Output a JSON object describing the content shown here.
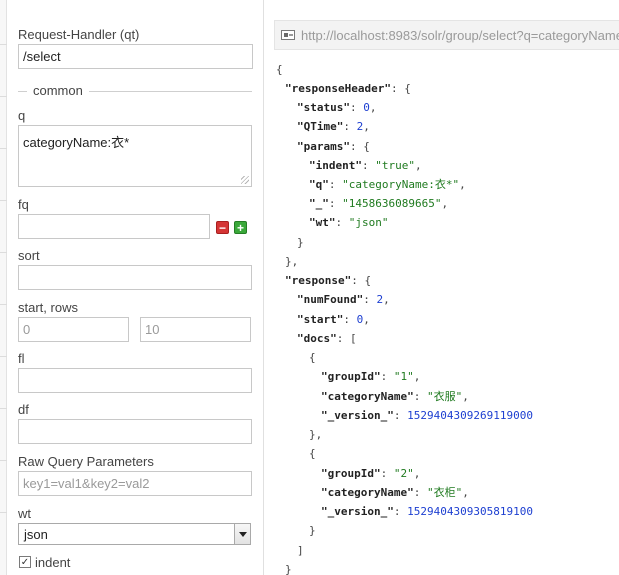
{
  "form": {
    "request_handler": {
      "label": "Request-Handler (qt)",
      "value": "/select"
    },
    "common_legend": "common",
    "q": {
      "label": "q",
      "value": "categoryName:衣*"
    },
    "fq": {
      "label": "fq",
      "value": "",
      "remove_icon": "minus-icon",
      "add_icon": "plus-icon"
    },
    "sort": {
      "label": "sort",
      "value": ""
    },
    "start_rows": {
      "label": "start, rows",
      "start_placeholder": "0",
      "rows_placeholder": "10"
    },
    "fl": {
      "label": "fl",
      "value": ""
    },
    "df": {
      "label": "df",
      "value": ""
    },
    "raw_params": {
      "label": "Raw Query Parameters",
      "placeholder": "key1=val1&key2=val2"
    },
    "wt": {
      "label": "wt",
      "selected": "json"
    },
    "indent": {
      "label": "indent",
      "checked": true
    }
  },
  "result": {
    "url": "http://localhost:8983/solr/group/select?q=categoryName",
    "url_icon": "link-icon",
    "response_header": {
      "status": "0",
      "qtime": "2",
      "params": {
        "indent": "\"true\"",
        "q": "\"categoryName:衣*\"",
        "underscore": "\"1458636089665\"",
        "wt": "\"json\""
      }
    },
    "response": {
      "num_found": "2",
      "start": "0",
      "docs": [
        {
          "group_id": "\"1\"",
          "category_name": "\"衣服\"",
          "version": "1529404309269119000"
        },
        {
          "group_id": "\"2\"",
          "category_name": "\"衣柜\"",
          "version": "1529404309305819100"
        }
      ]
    }
  }
}
